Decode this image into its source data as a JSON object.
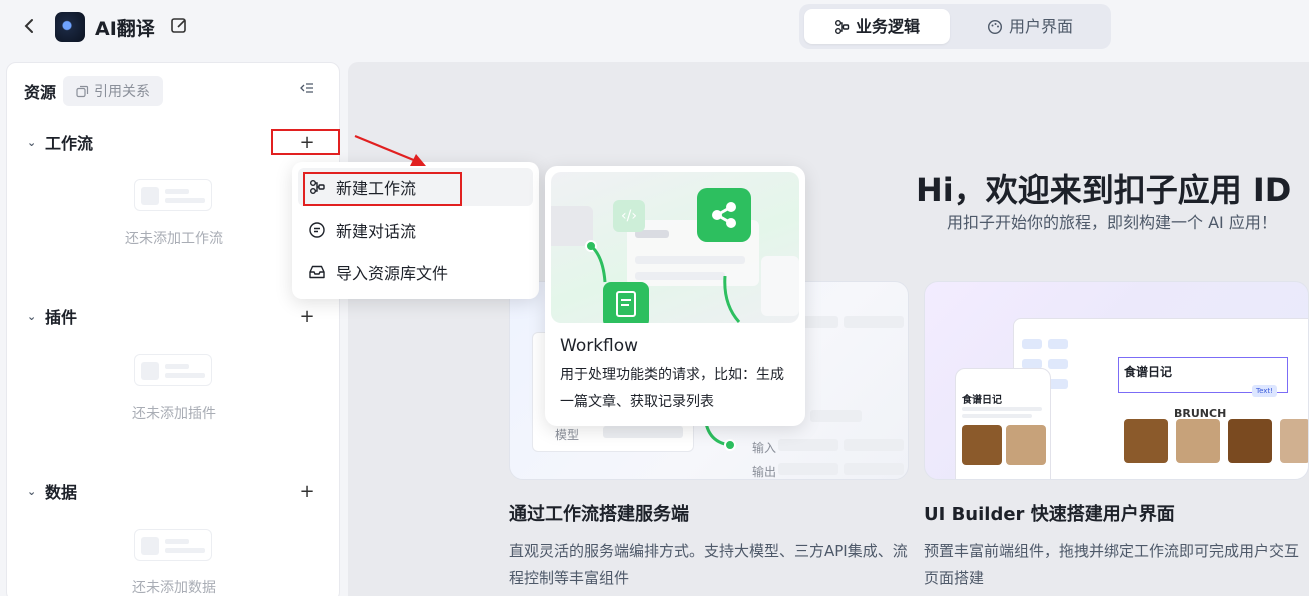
{
  "header": {
    "back_icon": "chevron-left-icon",
    "app_name": "AI翻译",
    "edit_icon": "edit-icon",
    "tabs": [
      {
        "label": "业务逻辑",
        "icon": "workflow-icon",
        "active": true
      },
      {
        "label": "用户界面",
        "icon": "palette-icon",
        "active": false
      }
    ]
  },
  "sidebar": {
    "title": "资源",
    "ref_chip": "引用关系",
    "sections": [
      {
        "label": "工作流",
        "empty": "还未添加工作流"
      },
      {
        "label": "插件",
        "empty": "还未添加插件"
      },
      {
        "label": "数据",
        "empty": "还未添加数据"
      }
    ]
  },
  "menu": {
    "items": [
      {
        "label": "新建工作流",
        "icon": "workflow-icon"
      },
      {
        "label": "新建对话流",
        "icon": "chat-icon"
      },
      {
        "label": "导入资源库文件",
        "icon": "inbox-icon"
      }
    ]
  },
  "tooltip": {
    "title": "Workflow",
    "desc": "用于处理功能类的请求，比如：生成一篇文章、获取记录列表"
  },
  "main": {
    "greeting": "Hi，欢迎来到扣子应用 ID",
    "subtitle": "用扣子开始你的旅程，即刻构建一个 AI 应用！",
    "cards": [
      {
        "title": "通过工作流搭建服务端",
        "desc": "直观灵活的服务端编排方式。支持大模型、三方API集成、流程控制等丰富组件",
        "mock_labels": [
          "模型",
          "输入",
          "输出"
        ]
      },
      {
        "title": "UI Builder 快速搭建用户界面",
        "desc": "预置丰富前端组件，拖拽并绑定工作流即可完成用户交互页面搭建",
        "mock_labels": [
          "食谱日记",
          "食谱日记",
          "Text!",
          "BRUNCH"
        ]
      }
    ]
  },
  "colors": {
    "accent_green": "#2dbf5f",
    "annotation_red": "#e12020"
  }
}
